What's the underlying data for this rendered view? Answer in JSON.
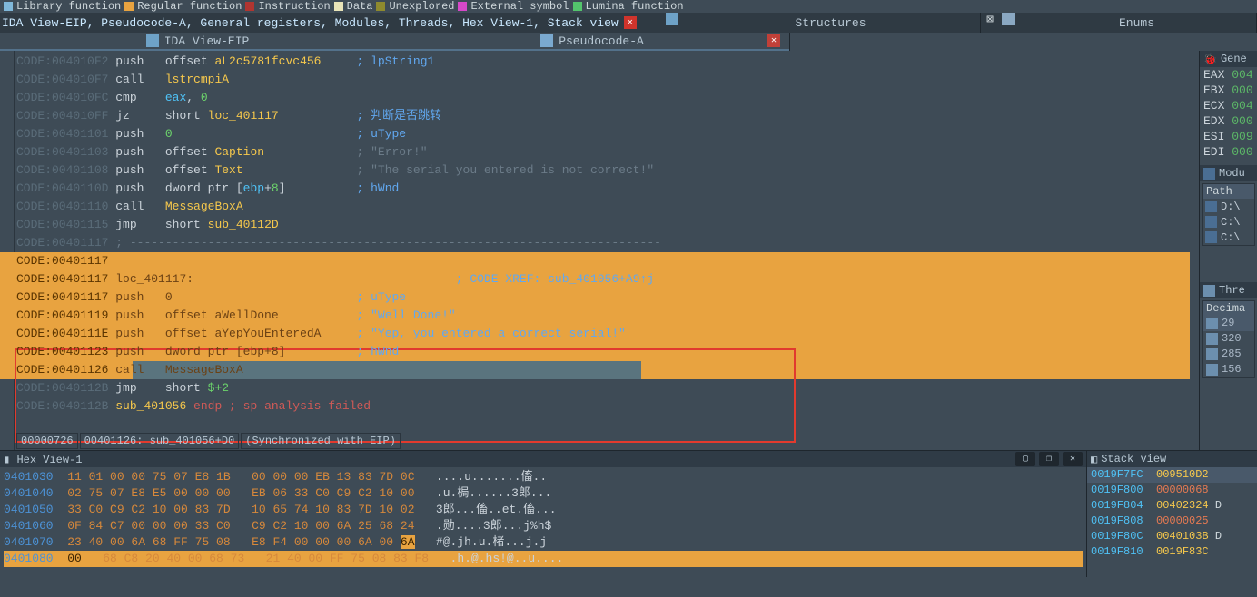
{
  "legend": {
    "items": [
      {
        "color": "#7FB7D9",
        "label": "Library function"
      },
      {
        "color": "#E8A340",
        "label": "Regular function"
      },
      {
        "color": "#B03530",
        "label": "Instruction"
      },
      {
        "color": "#E8E4B8",
        "label": "Data"
      },
      {
        "color": "#8E8A2E",
        "label": "Unexplored"
      },
      {
        "color": "#D648C8",
        "label": "External symbol"
      },
      {
        "color": "#53C46C",
        "label": "Lumina function"
      }
    ]
  },
  "breadcrumb": "IDA View-EIP, Pseudocode-A, General registers, Modules, Threads, Hex View-1, Stack view",
  "main_tabs": [
    {
      "id": "structures",
      "label": "Structures",
      "closable": true
    },
    {
      "id": "enums",
      "label": "Enums"
    }
  ],
  "sub_tabs": [
    {
      "id": "ida-view",
      "label": "IDA View-EIP",
      "active": true
    },
    {
      "id": "pseudocode",
      "label": "Pseudocode-A",
      "active": true
    }
  ],
  "disasm_lines": [
    {
      "dot": "blue",
      "addr": "CODE:004010F2",
      "mnem": "push",
      "op": "offset ",
      "sym": "aL2c5781fcvc456",
      "symcls": "name-yel",
      "cmt": "; lpString1",
      "cmtcls": "cmt-blue"
    },
    {
      "dot": "blue",
      "addr": "CODE:004010F7",
      "mnem": "call",
      "op": "",
      "sym": "lstrcmpiA",
      "symcls": "name-yel"
    },
    {
      "dot": "blue",
      "addr": "CODE:004010FC",
      "mnem": "cmp",
      "op": "",
      "sym": "eax",
      "symcls": "name-cyan",
      "post": ", ",
      "num": "0"
    },
    {
      "dot": "blue",
      "addr": "CODE:004010FF",
      "mnem": "jz",
      "op": "short ",
      "sym": "loc_401117",
      "symcls": "name-yel",
      "cmt": "; 判断是否跳转",
      "cmtcls": "cmt-blue"
    },
    {
      "dot": "blue",
      "addr": "CODE:00401101",
      "mnem": "push",
      "op": "",
      "num": "0",
      "cmt": "; uType",
      "cmtcls": "cmt-blue"
    },
    {
      "dot": "blue",
      "addr": "CODE:00401103",
      "mnem": "push",
      "op": "offset ",
      "sym": "Caption",
      "symcls": "name-yel",
      "cmt": "; \"Error!\"",
      "cmtcls": "cmt-grey"
    },
    {
      "dot": "blue",
      "addr": "CODE:00401108",
      "mnem": "push",
      "op": "offset ",
      "sym": "Text",
      "symcls": "name-yel",
      "cmt": "; \"The serial you entered is not correct!\"",
      "cmtcls": "cmt-grey"
    },
    {
      "dot": "blue",
      "addr": "CODE:0040110D",
      "mnem": "push",
      "op": "dword ptr [",
      "sym": "ebp",
      "symcls": "name-cyan",
      "post": "+",
      "num": "8",
      "post2": "]",
      "cmt": "; hWnd",
      "cmtcls": "cmt-blue"
    },
    {
      "dot": "blue",
      "addr": "CODE:00401110",
      "mnem": "call",
      "op": "",
      "sym": "MessageBoxA",
      "symcls": "name-yel"
    },
    {
      "dot": "grey",
      "addr": "CODE:00401115",
      "mnem": "jmp",
      "op": "short ",
      "sym": "sub_40112D",
      "symcls": "name-yel"
    },
    {
      "addr": "CODE:00401117",
      "dash": true
    },
    {
      "addr": "CODE:00401",
      "hi": true,
      "rest": "117"
    },
    {
      "addr": "CODE:00401117",
      "hi": true,
      "label": "loc_401117:",
      "cmt": "; CODE XREF: sub_401056+A9↑j",
      "cmtcls": "cmt-blue"
    },
    {
      "addr": "CODE:00401117",
      "hi": true,
      "mnem": "push",
      "num": "0",
      "cmt": "; uType",
      "cmtcls": "cmt-blue"
    },
    {
      "addr": "CODE:00401119",
      "hi": true,
      "mnem": "push",
      "op": "offset ",
      "sym": "aWellDone",
      "cmt": "; \"Well Done!\"",
      "cmtcls": "cmt-blue"
    },
    {
      "addr": "CODE:0040111E",
      "hi": true,
      "mnem": "push",
      "op": "offset ",
      "sym": "aYepYouEnteredA",
      "cmt": "; \"Yep, you entered a correct serial!\"",
      "cmtcls": "cmt-blue"
    },
    {
      "addr": "CODE:00401123",
      "hi": true,
      "mnem": "push",
      "op": "dword ptr [ebp+8]",
      "cmt": "; hWnd",
      "cmtcls": "cmt-blue"
    },
    {
      "addr": "CODE:00401126",
      "hi": true,
      "cursor": true,
      "mnem": "call",
      "op": "",
      "sym": "MessageBoxA"
    },
    {
      "dot": "grey",
      "addr": "CODE:0040112B",
      "mnem": "jmp",
      "op": "short ",
      "sym": "$+2",
      "symcls": "name-grn"
    },
    {
      "addr": "CODE:0040112B",
      "sym": "sub_401056",
      "symcls": "name-yel",
      "tail": " endp ; sp-analysis failed",
      "tailcls": "kw-red"
    }
  ],
  "status": {
    "offset": "00000726",
    "loc": "00401126: sub_401056+D0",
    "sync": "(Synchronized with EIP)"
  },
  "registers": {
    "title": "Gene",
    "items": [
      {
        "n": "EAX",
        "v": "004"
      },
      {
        "n": "EBX",
        "v": "000"
      },
      {
        "n": "ECX",
        "v": "004"
      },
      {
        "n": "EDX",
        "v": "000"
      },
      {
        "n": "ESI",
        "v": "009"
      },
      {
        "n": "EDI",
        "v": "000"
      }
    ]
  },
  "modules": {
    "title": "Modu",
    "path_header": "Path",
    "rows": [
      "D:\\",
      "C:\\",
      "C:\\"
    ]
  },
  "threads": {
    "title": "Thre",
    "decimal_header": "Decima",
    "rows": [
      "29",
      "320",
      "285",
      "156"
    ]
  },
  "hex": {
    "title": "Hex View-1",
    "lines": [
      {
        "a": "0401030",
        "b": "11 01 00 00 75 07 E8 1B",
        "b2": "00 00 00 EB 13 83 7D 0C",
        "asc": "....u.......傗.."
      },
      {
        "a": "0401040",
        "b": "02 75 07 E8 E5 00 00 00",
        "b2": "EB 06 33 C0 C9 C2 10 00",
        "asc": ".u.梮......3郎..."
      },
      {
        "a": "0401050",
        "b": "33 C0 C9 C2 10 00 83 7D",
        "b2": "10 65 74 10 83 7D 10 02",
        "asc": "3郎...傗..et.傗..."
      },
      {
        "a": "0401060",
        "b": "0F 84 C7 00 00 00 33 C0",
        "b2": "C9 C2 10 00 6A 25 68 24",
        "asc": ".勋....3郎...j%h$"
      },
      {
        "a": "0401070",
        "b": "23 40 00 6A 68 FF 75 08",
        "b2": "E8 F4 00 00 00 6A 00 ",
        "asc": "#@.jh.u.楮...j.j",
        "hib": "6A"
      },
      {
        "a": "0401080",
        "b": "   68 C8 20 40 00 68 73",
        "b2": "21 40 00 FF 75 08 83 F8",
        "asc": ".h.@.hs!@..u....",
        "active": true,
        "hib0": "00"
      }
    ]
  },
  "stack": {
    "title": "Stack view",
    "rows": [
      {
        "a": "0019F7FC",
        "v": "009510D2",
        "cls": "st-v-y",
        "hi": true
      },
      {
        "a": "0019F800",
        "v": "00000068",
        "cls": "st-v-r"
      },
      {
        "a": "0019F804",
        "v": "00402324",
        "cls": "st-v-y",
        "tail": "D"
      },
      {
        "a": "0019F808",
        "v": "00000025",
        "cls": "st-v-r"
      },
      {
        "a": "0019F80C",
        "v": "0040103B",
        "cls": "st-v-y",
        "tail": "D"
      },
      {
        "a": "0019F810",
        "v": "0019F83C",
        "cls": "st-v-y"
      }
    ]
  }
}
